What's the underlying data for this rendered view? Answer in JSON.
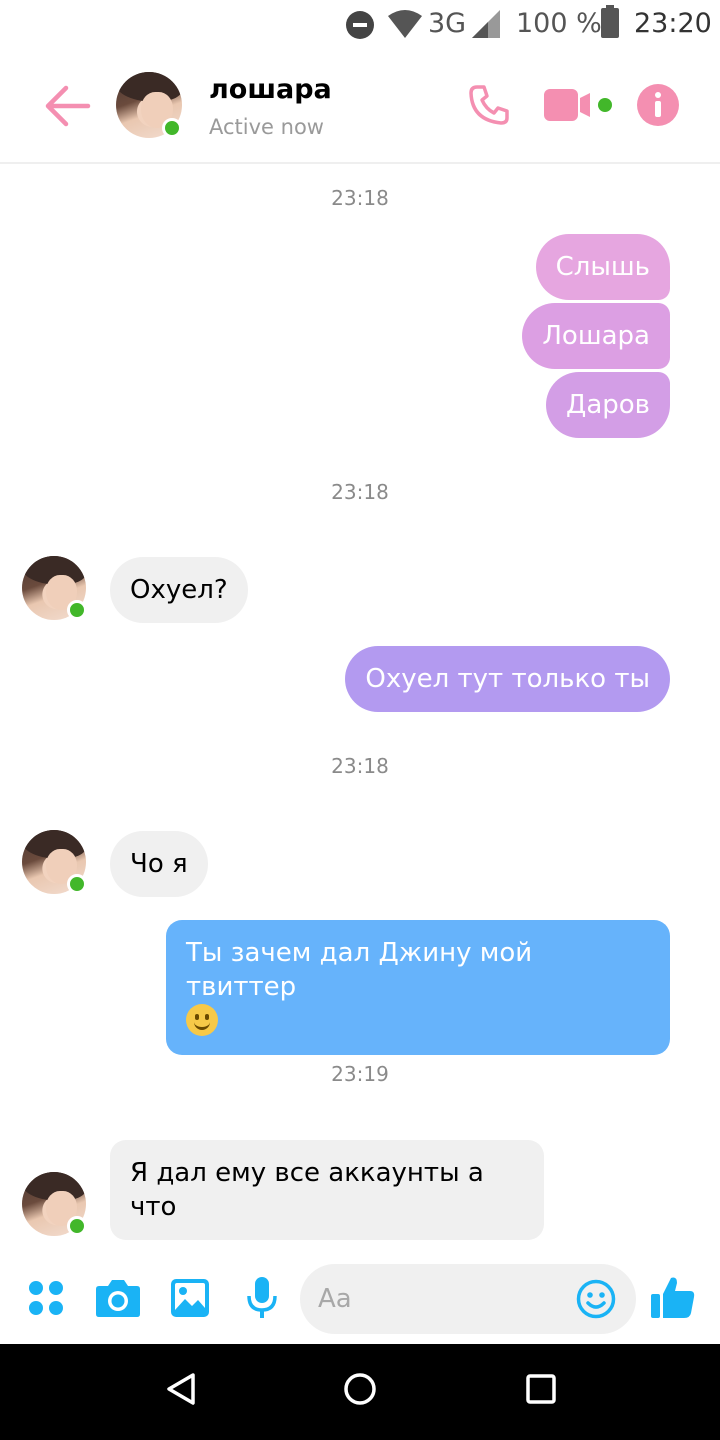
{
  "status_bar": {
    "network": "3G",
    "battery": "100 %",
    "time": "23:20"
  },
  "header": {
    "contact_name": "лошара",
    "presence": "Active now",
    "accent_color": "#f48fb1"
  },
  "messages": [
    {
      "type": "time",
      "text": "23:18"
    },
    {
      "type": "out",
      "text": "Слышь",
      "color": "#e6a6e0"
    },
    {
      "type": "out",
      "text": "Лошара",
      "color": "#dc9fe3"
    },
    {
      "type": "out",
      "text": "Даров",
      "color": "#d39ee6"
    },
    {
      "type": "time",
      "text": "23:18"
    },
    {
      "type": "in",
      "text": "Охуел?"
    },
    {
      "type": "out",
      "text": "Охуел тут только ты",
      "color": "#b39af0"
    },
    {
      "type": "time",
      "text": "23:18"
    },
    {
      "type": "in",
      "text": "Чо я"
    },
    {
      "type": "out",
      "text": "Ты зачем дал Джину мой твиттер",
      "emoji": "slightly-smiling-face",
      "color": "#66b3fb"
    },
    {
      "type": "time",
      "text": "23:19"
    },
    {
      "type": "in",
      "text": "Я дал ему все аккаунты а что"
    }
  ],
  "composer": {
    "placeholder": "Aa",
    "icon_color": "#1ab3f5"
  },
  "icons": [
    "back-arrow-icon",
    "phone-icon",
    "video-icon",
    "info-icon",
    "apps-icon",
    "camera-icon",
    "gallery-icon",
    "microphone-icon",
    "emoji-icon",
    "like-icon"
  ]
}
